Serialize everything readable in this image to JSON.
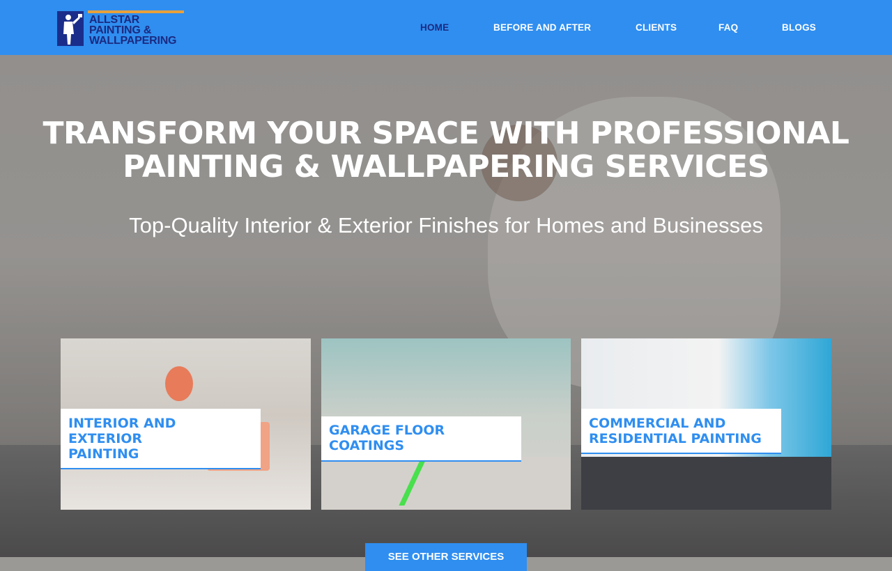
{
  "brand": {
    "name_line1": "ALLSTAR",
    "name_line2": "PAINTING &",
    "name_line3": "WALLPAPERING",
    "color_primary": "#2f8ef0",
    "color_dark": "#1b2a80",
    "color_accent": "#e8a13a"
  },
  "nav": {
    "items": [
      {
        "label": "HOME",
        "active": true
      },
      {
        "label": "BEFORE AND AFTER",
        "active": false
      },
      {
        "label": "CLIENTS",
        "active": false
      },
      {
        "label": "FAQ",
        "active": false
      },
      {
        "label": "BLOGS",
        "active": false
      }
    ]
  },
  "hero": {
    "headline_line1": "TRANSFORM YOUR SPACE WITH PROFESSIONAL",
    "headline_line2": "PAINTING & WALLPAPERING SERVICES",
    "subheadline": "Top-Quality Interior & Exterior Finishes for Homes and Businesses"
  },
  "services": [
    {
      "title_line1": "INTERIOR AND EXTERIOR",
      "title_line2": "PAINTING"
    },
    {
      "title_line1": "GARAGE FLOOR COATINGS",
      "title_line2": ""
    },
    {
      "title_line1": "COMMERCIAL AND",
      "title_line2": "RESIDENTIAL PAINTING"
    }
  ],
  "cta": {
    "label": "SEE OTHER SERVICES"
  }
}
